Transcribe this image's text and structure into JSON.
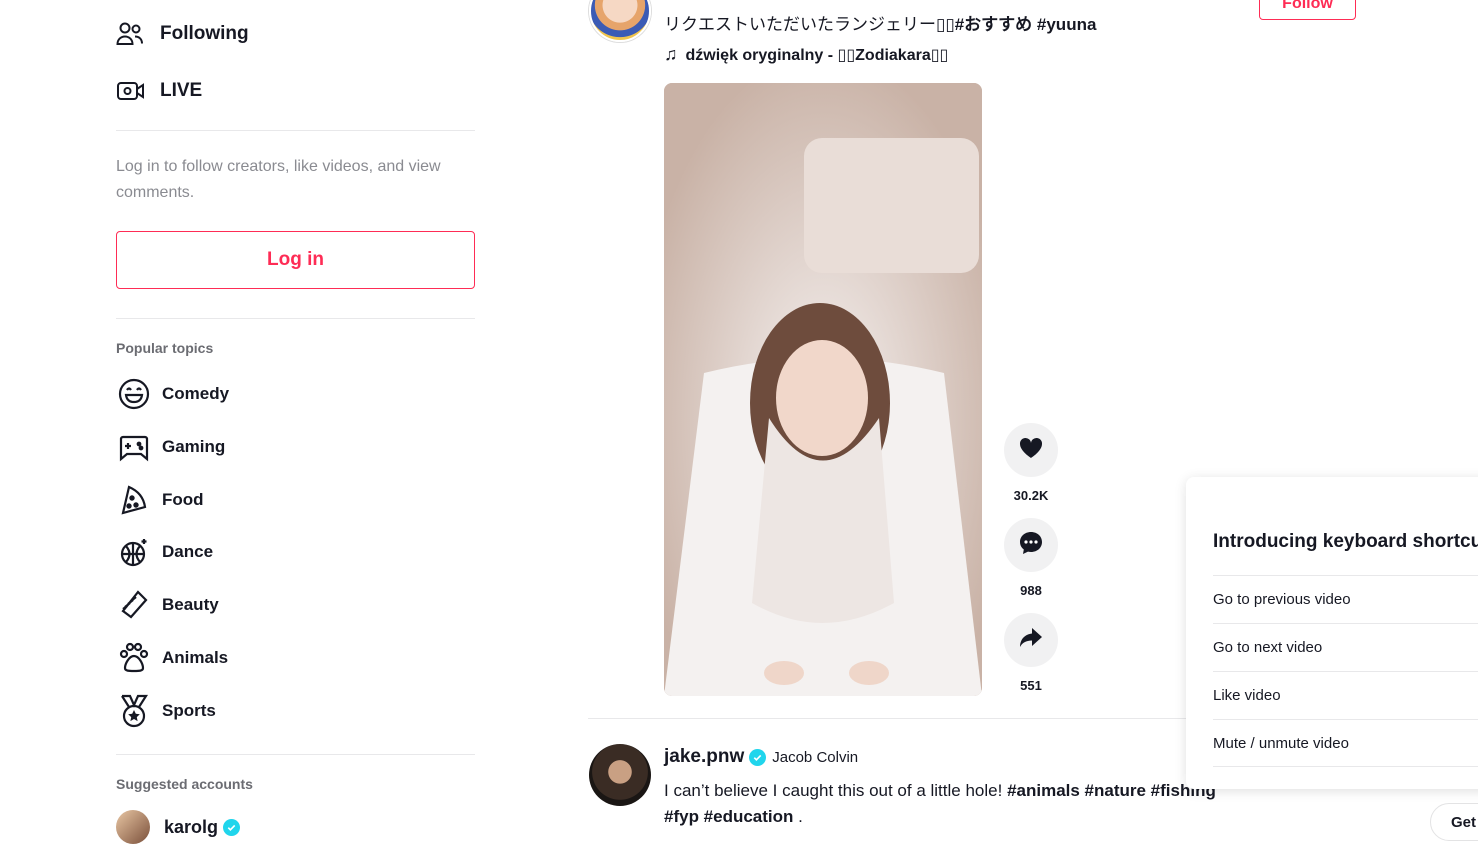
{
  "sidebar": {
    "nav": [
      {
        "label": "Following",
        "icon": "following-icon"
      },
      {
        "label": "LIVE",
        "icon": "live-icon"
      }
    ],
    "login_hint": "Log in to follow creators, like videos, and view comments.",
    "login_label": "Log in",
    "popular_topics_title": "Popular topics",
    "topics": [
      {
        "label": "Comedy",
        "icon": "comedy-icon"
      },
      {
        "label": "Gaming",
        "icon": "gaming-icon"
      },
      {
        "label": "Food",
        "icon": "food-icon"
      },
      {
        "label": "Dance",
        "icon": "dance-icon"
      },
      {
        "label": "Beauty",
        "icon": "beauty-icon"
      },
      {
        "label": "Animals",
        "icon": "animals-icon"
      },
      {
        "label": "Sports",
        "icon": "sports-icon"
      }
    ],
    "suggested_title": "Suggested accounts",
    "suggested": [
      {
        "name": "karolg",
        "verified": true
      }
    ]
  },
  "feed": {
    "post1": {
      "caption_text": "リクエストいただいたランジェリー▯▯",
      "caption_tags": "#おすすめ #yuuna",
      "music": "dźwięk oryginalny - ▯▯Zodiakara▯▯",
      "follow_label": "Follow",
      "likes": "30.2K",
      "comments": "988",
      "shares": "551"
    },
    "post2": {
      "username": "jake.pnw",
      "nickname": "Jacob Colvin",
      "verified": true,
      "caption_text": "I can’t believe I caught this out of a little hole!",
      "caption_tags": "#animals #nature #fishing #fyp #education",
      "caption_end": "."
    }
  },
  "shortcuts": {
    "title": "Introducing keyboard shortcuts",
    "rows": [
      {
        "label": "Go to previous video"
      },
      {
        "label": "Go to next video"
      },
      {
        "label": "Like video"
      },
      {
        "label": "Mute / unmute video"
      }
    ]
  },
  "get_app_label": "Get app",
  "colors": {
    "brand": "#fe2c55",
    "verified": "#20d5ec",
    "text": "#161823",
    "muted": "#8a8b91"
  }
}
